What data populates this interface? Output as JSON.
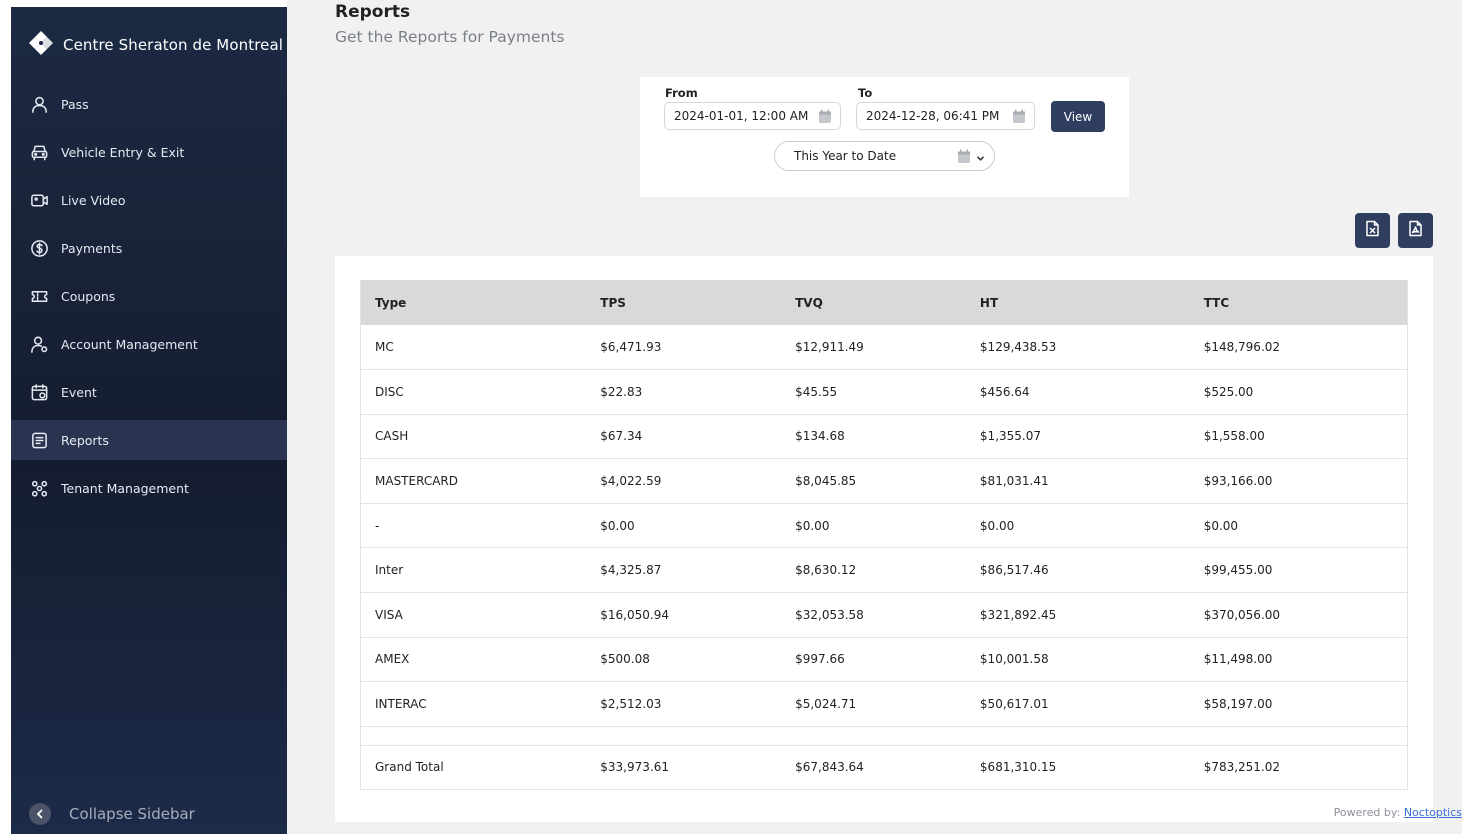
{
  "sidebar": {
    "brand": "Centre Sheraton de Montreal",
    "items": [
      {
        "label": "Pass",
        "icon": "user-icon"
      },
      {
        "label": "Vehicle Entry & Exit",
        "icon": "car-icon"
      },
      {
        "label": "Live Video",
        "icon": "video-icon"
      },
      {
        "label": "Payments",
        "icon": "dollar-icon"
      },
      {
        "label": "Coupons",
        "icon": "ticket-icon"
      },
      {
        "label": "Account Management",
        "icon": "user-settings-icon"
      },
      {
        "label": "Event",
        "icon": "calendar-icon"
      },
      {
        "label": "Reports",
        "icon": "report-icon",
        "active": true
      },
      {
        "label": "Tenant Management",
        "icon": "group-icon"
      }
    ],
    "collapse_label": "Collapse Sidebar"
  },
  "header": {
    "title": "Reports",
    "subtitle": "Get the Reports for Payments"
  },
  "filters": {
    "from_label": "From",
    "from_value": "2024-01-01, 12:00 AM",
    "to_label": "To",
    "to_value": "2024-12-28, 06:41 PM",
    "view_label": "View",
    "range_value": "This Year to Date"
  },
  "table": {
    "headers": [
      "Type",
      "TPS",
      "TVQ",
      "HT",
      "TTC"
    ],
    "rows": [
      [
        "MC",
        "$6,471.93",
        "$12,911.49",
        "$129,438.53",
        "$148,796.02"
      ],
      [
        "DISC",
        "$22.83",
        "$45.55",
        "$456.64",
        "$525.00"
      ],
      [
        "CASH",
        "$67.34",
        "$134.68",
        "$1,355.07",
        "$1,558.00"
      ],
      [
        "MASTERCARD",
        "$4,022.59",
        "$8,045.85",
        "$81,031.41",
        "$93,166.00"
      ],
      [
        "-",
        "$0.00",
        "$0.00",
        "$0.00",
        "$0.00"
      ],
      [
        "Inter",
        "$4,325.87",
        "$8,630.12",
        "$86,517.46",
        "$99,455.00"
      ],
      [
        "VISA",
        "$16,050.94",
        "$32,053.58",
        "$321,892.45",
        "$370,056.00"
      ],
      [
        "AMEX",
        "$500.08",
        "$997.66",
        "$10,001.58",
        "$11,498.00"
      ],
      [
        "INTERAC",
        "$2,512.03",
        "$5,024.71",
        "$50,617.01",
        "$58,197.00"
      ]
    ],
    "total": [
      "Grand Total",
      "$33,973.61",
      "$67,843.64",
      "$681,310.15",
      "$783,251.02"
    ]
  },
  "footer": {
    "powered_label": "Powered by:",
    "powered_link": "Noctoptics"
  }
}
